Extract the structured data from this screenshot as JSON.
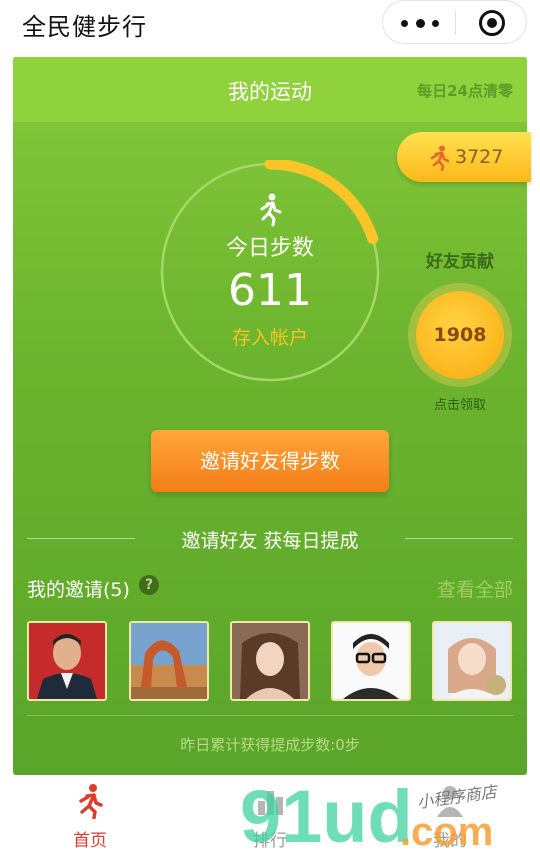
{
  "app": {
    "title": "全民健步行"
  },
  "capsule": {
    "more_icon": "more-dots-icon",
    "close_icon": "target-close-icon"
  },
  "card": {
    "title": "我的运动",
    "reset_note": "每日24点清零",
    "total_steps": "3727",
    "today_label": "今日步数",
    "today_steps": "611",
    "today_progress_fraction": 0.2,
    "save_link": "存入帐户",
    "friend_title": "好友贡献",
    "friend_steps": "1908",
    "claim_label": "点击领取",
    "invite_button": "邀请好友得步数",
    "invite_slogan": "邀请好友 获每日提成",
    "my_invites": "我的邀请(5)",
    "help_glyph": "?",
    "view_all": "查看全部",
    "avatars": [
      {
        "name": "friend-1",
        "bg": "#c62b2b"
      },
      {
        "name": "friend-2",
        "bg": "#5f8dbd"
      },
      {
        "name": "friend-3",
        "bg": "#c99677"
      },
      {
        "name": "friend-4",
        "bg": "#ffffff"
      },
      {
        "name": "friend-5",
        "bg": "#e8eff6"
      }
    ],
    "yesterday_text": "昨日累计获得提成步数:0步"
  },
  "tabs": [
    {
      "label": "首页",
      "icon": "runner-icon",
      "active": true
    },
    {
      "label": "排行",
      "icon": "ranking-icon",
      "active": false
    },
    {
      "label": "我的",
      "icon": "user-icon",
      "active": false
    }
  ],
  "watermark": {
    "text": "91ud.com",
    "tagline": "小程序商店"
  },
  "colors": {
    "accent_red": "#e13a2a",
    "gold": "#f7c523",
    "green": "#6db52f"
  }
}
